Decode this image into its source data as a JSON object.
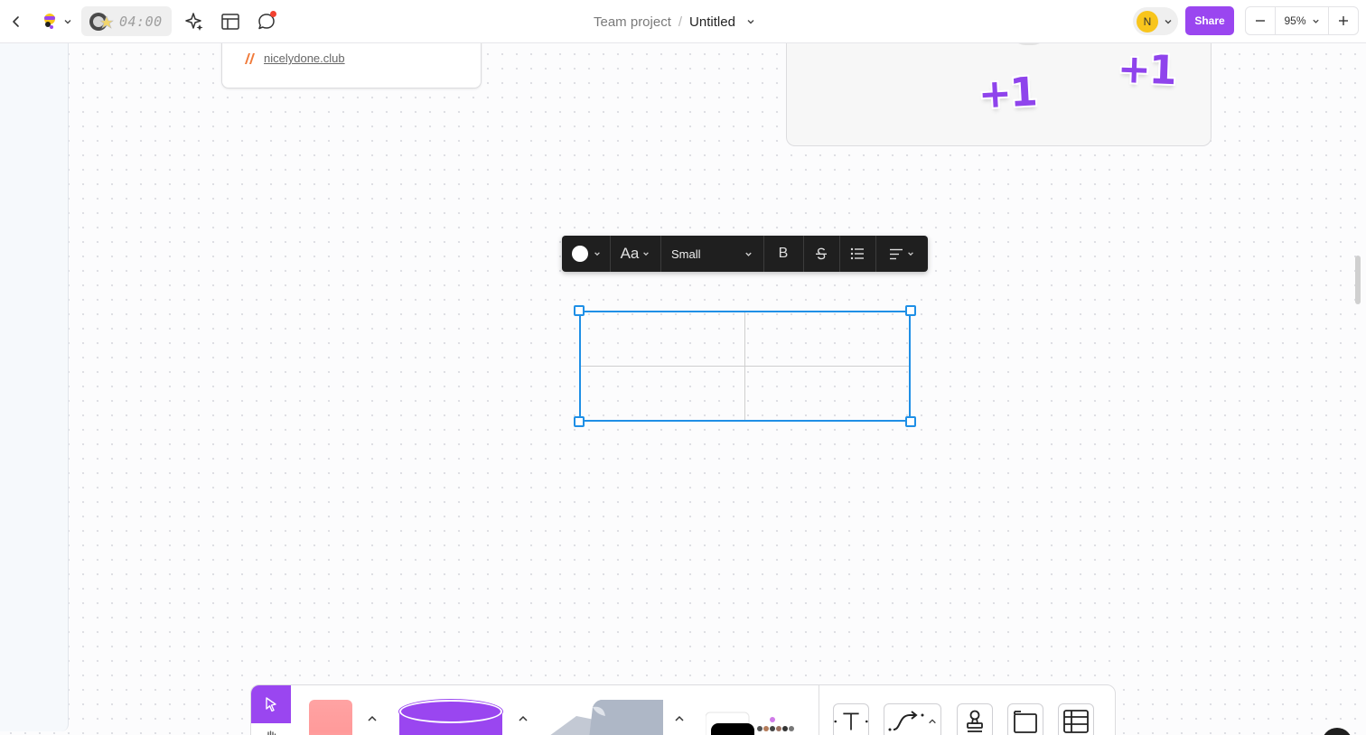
{
  "header": {
    "timer": "04:00",
    "breadcrumb": {
      "project": "Team project",
      "separator": "/",
      "title": "Untitled"
    },
    "avatar_initial": "N",
    "share_label": "Share",
    "zoom": {
      "value": "95%",
      "minus": "−",
      "plus": "+"
    }
  },
  "canvas": {
    "link_card": {
      "link_text": "nicelydone.club"
    },
    "reaction_card": {
      "stickers": [
        "+1",
        "+1"
      ]
    }
  },
  "format_toolbar": {
    "text_color": "#ffffff",
    "font_label": "Aa",
    "size_value": "Small",
    "bold_label": "B"
  },
  "colors": {
    "accent": "#9a46f0",
    "selection": "#1f8fe6",
    "sticky_note": "#ffa3a3",
    "avatar": "#f8c51c",
    "notification": "#f2412f"
  },
  "bottom_toolbar": {
    "tools": [
      "select-tool",
      "hand-tool",
      "sticky-note-tool",
      "shape-tool",
      "paper-tool",
      "stack-tool",
      "text-tool",
      "connector-tool",
      "stamp-tool",
      "frame-tool",
      "table-tool"
    ]
  }
}
